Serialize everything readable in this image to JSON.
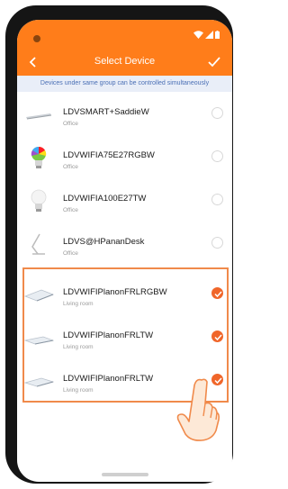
{
  "header": {
    "title": "Select Device",
    "back_icon": "chevron-left-icon",
    "confirm_icon": "checkmark-icon",
    "color": "#ff7d1a"
  },
  "notice": "Devices under same group can be controlled simultaneously",
  "devices": [
    {
      "name": "LDVSMART+SaddieW",
      "room": "Office",
      "icon": "desk-lamp-icon",
      "selected": false
    },
    {
      "name": "LDVWIFIA75E27RGBW",
      "room": "Office",
      "icon": "rgb-bulb-icon",
      "selected": false
    },
    {
      "name": "LDVWIFIA100E27TW",
      "room": "Office",
      "icon": "bulb-icon",
      "selected": false
    },
    {
      "name": "LDVS@HPananDesk",
      "room": "Office",
      "icon": "desk-lamp-icon",
      "selected": false
    },
    {
      "name": "LDVWIFIPlanonFRLRGBW",
      "room": "Living room",
      "icon": "panel-light-icon",
      "selected": true
    },
    {
      "name": "LDVWIFIPlanonFRLTW",
      "room": "Living room",
      "icon": "panel-light-icon",
      "selected": true
    },
    {
      "name": "LDVWIFIPlanonFRLTW",
      "room": "Living room",
      "icon": "panel-light-icon",
      "selected": true
    }
  ],
  "accent_color": "#f0662a",
  "highlight_color": "#f08a4b"
}
